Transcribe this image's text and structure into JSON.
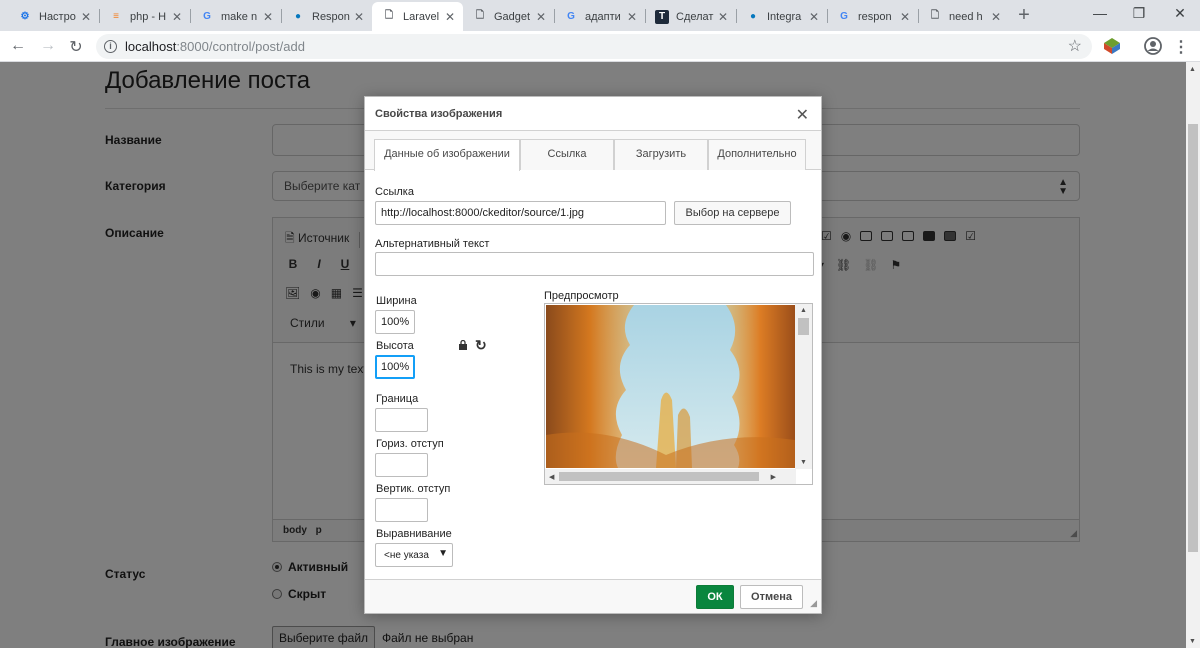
{
  "browser": {
    "tabs": [
      {
        "label": "Настро",
        "icon": "gear-icon",
        "color": "#1a73e8"
      },
      {
        "label": "php - H",
        "icon": "stackoverflow-icon",
        "color": "#f48024"
      },
      {
        "label": "make n",
        "icon": "google-icon",
        "color": "#4285f4"
      },
      {
        "label": "Respon",
        "icon": "drupal-icon",
        "color": "#0678be"
      },
      {
        "label": "Laravel",
        "icon": "page-icon",
        "color": "#5f6368"
      },
      {
        "label": "Gadget",
        "icon": "page-icon",
        "color": "#5f6368"
      },
      {
        "label": "адапти",
        "icon": "google-icon",
        "color": "#4285f4"
      },
      {
        "label": "Сделат",
        "icon": "tutsplus-icon",
        "color": "#1e2a3a"
      },
      {
        "label": "Integra",
        "icon": "drupal-icon",
        "color": "#0678be"
      },
      {
        "label": "respon",
        "icon": "google-icon",
        "color": "#4285f4"
      },
      {
        "label": "need h",
        "icon": "page-icon",
        "color": "#5f6368"
      }
    ],
    "active_tab_index": 4,
    "url_host": "localhost",
    "url_path": ":8000/control/post/add"
  },
  "page": {
    "title": "Добавление поста",
    "fields": {
      "name_label": "Название",
      "category_label": "Категория",
      "category_placeholder": "Выберите кат",
      "description_label": "Описание",
      "status_label": "Статус",
      "main_image_label": "Главное изображение"
    },
    "editor": {
      "source_label": "Источник",
      "styles_label": "Стили",
      "bold": "B",
      "italic": "I",
      "underline": "U",
      "content_text": "This is my text",
      "path_body": "body",
      "path_p": "p"
    },
    "status_options": [
      {
        "label": "Активный",
        "checked": true
      },
      {
        "label": "Скрыт",
        "checked": false
      }
    ],
    "file_button": "Выберите файл",
    "file_status": "Файл не выбран"
  },
  "dialog": {
    "title": "Свойства изображения",
    "tabs": [
      "Данные об изображении",
      "Ссылка",
      "Загрузить",
      "Дополнительно"
    ],
    "active_tab": 0,
    "url_label": "Ссылка",
    "url_value": "http://localhost:8000/ckeditor/source/1.jpg",
    "browse_server": "Выбор на сервере",
    "alt_label": "Альтернативный текст",
    "alt_value": "",
    "width_label": "Ширина",
    "width_value": "100%",
    "height_label": "Высота",
    "height_value": "100%",
    "border_label": "Граница",
    "hspace_label": "Гориз. отступ",
    "vspace_label": "Вертик. отступ",
    "align_label": "Выравнивание",
    "align_value": "<не указа",
    "preview_label": "Предпросмотр",
    "ok": "ОК",
    "cancel": "Отмена"
  },
  "colors": {
    "ok_green": "#09863e",
    "focus_blue": "#139ff7",
    "overlay": "rgba(0,0,0,0.5)"
  }
}
